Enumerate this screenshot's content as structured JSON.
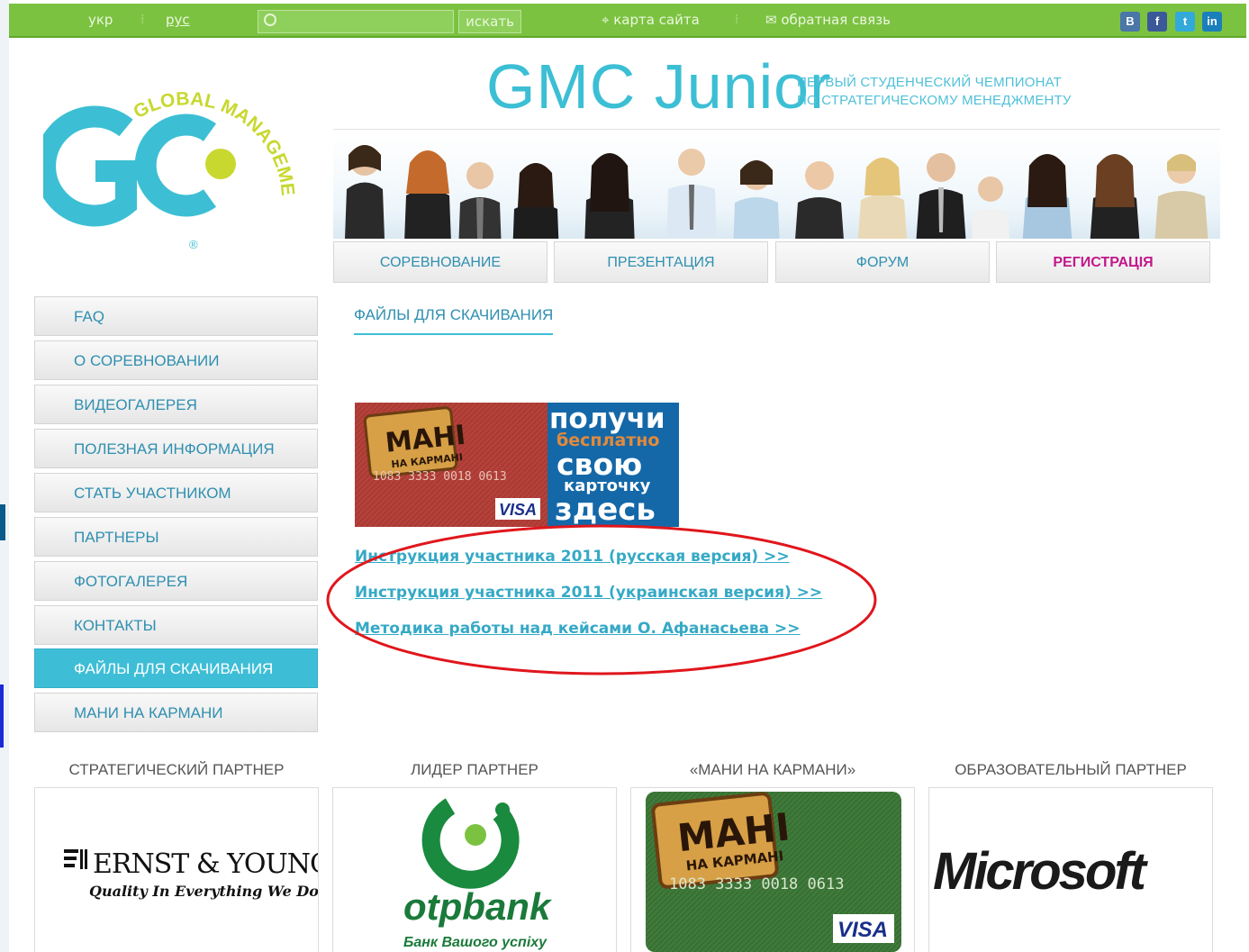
{
  "topbar": {
    "lang_ukr": "укр",
    "lang_rus": "рус",
    "search_placeholder": "",
    "search_button": "искать",
    "sitemap": "карта сайта",
    "feedback": "обратная связь",
    "social": [
      {
        "icon": "vkontakte-icon",
        "label": "В",
        "color": "#4a76a8"
      },
      {
        "icon": "facebook-icon",
        "label": "f",
        "color": "#3b5998"
      },
      {
        "icon": "twitter-icon",
        "label": "t",
        "color": "#33a9d9"
      },
      {
        "icon": "linkedin-icon",
        "label": "in",
        "color": "#1a7fbb"
      }
    ]
  },
  "logo": {
    "letters": "GC",
    "ring_text": "GLOBAL MANAGEMENT CHALLENGE",
    "registered": "®"
  },
  "header": {
    "title": "GMC Junior",
    "subtitle_line1": "ПЕРВЫЙ СТУДЕНЧЕСКИЙ ЧЕМПИОНАТ",
    "subtitle_line2": "ПО СТРАТЕГИЧЕСКОМУ МЕНЕДЖМЕНТУ"
  },
  "top_nav": [
    {
      "label": "СОРЕВНОВАНИЕ"
    },
    {
      "label": "ПРЕЗЕНТАЦИЯ"
    },
    {
      "label": "ФОРУМ"
    },
    {
      "label": "РЕГИСТРАЦІЯ"
    }
  ],
  "side_nav": [
    {
      "label": "FAQ"
    },
    {
      "label": "О СОРЕВНОВАНИИ"
    },
    {
      "label": "ВИДЕОГАЛЕРЕЯ"
    },
    {
      "label": "ПОЛЕЗНАЯ ИНФОРМАЦИЯ"
    },
    {
      "label": "СТАТЬ УЧАСТНИКОМ"
    },
    {
      "label": "ПАРТНЕРЫ"
    },
    {
      "label": "ФОТОГАЛЕРЕЯ"
    },
    {
      "label": "КОНТАКТЫ"
    },
    {
      "label": "ФАЙЛЫ ДЛЯ СКАЧИВАНИЯ"
    },
    {
      "label": "МАНИ НА КАРМАНИ"
    }
  ],
  "content": {
    "title": "ФАЙЛЫ ДЛЯ СКАЧИВАНИЯ",
    "promo": {
      "card_brand": "МАНІ",
      "card_sub": "НА КАРМАНІ",
      "card_number": "1083 3333 0018 0613",
      "card_network": "VISA",
      "line1": "получи",
      "line2": "бесплатно",
      "line3": "свою",
      "line4": "карточку",
      "line5": "здесь"
    },
    "links": [
      {
        "label": "Инструкция участника 2011 (русская версия) >>"
      },
      {
        "label": "Инструкция участника 2011 (украинская версия) >>"
      },
      {
        "label": "Методика работы над кейсами О. Афанасьева >>"
      }
    ]
  },
  "partners": [
    {
      "heading": "СТРАТЕГИЧЕСКИЙ ПАРТНЕР",
      "name": "ERNST & YOUNG",
      "tagline": "Quality In Everything We Do"
    },
    {
      "heading": "ЛИДЕР ПАРТНЕР",
      "name": "otpbank",
      "tagline": "Банк Вашого успіху"
    },
    {
      "heading": "«МАНИ НА КАРМАНИ»",
      "name": "МАНІ",
      "tagline": "НА КАРМАНІ",
      "card_number": "1083 3333 0018 0613",
      "card_network": "VISA"
    },
    {
      "heading": "ОБРАЗОВАТЕЛЬНЫЙ ПАРТНЕР",
      "name": "Microsoft"
    }
  ],
  "colors": {
    "topbar": "#7cc241",
    "accent": "#3ebed6",
    "link": "#35a9c6",
    "registration": "#c2188b",
    "annotation_ellipse": "#e0161c"
  }
}
